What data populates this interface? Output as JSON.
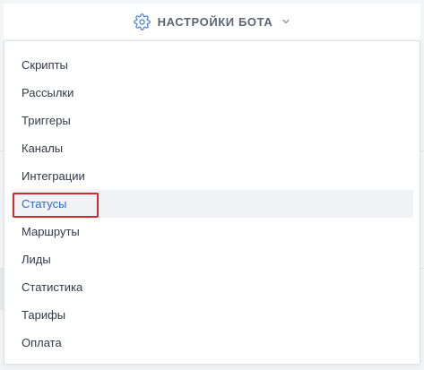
{
  "header": {
    "title": "НАСТРОЙКИ БОТА",
    "icon": "gear-icon",
    "dropdown_icon": "chevron-down-icon"
  },
  "menu": {
    "items": [
      {
        "label": "Скрипты"
      },
      {
        "label": "Рассылки"
      },
      {
        "label": "Триггеры"
      },
      {
        "label": "Каналы"
      },
      {
        "label": "Интеграции"
      },
      {
        "label": "Статусы",
        "selected": true
      },
      {
        "label": "Маршруты"
      },
      {
        "label": "Лиды"
      },
      {
        "label": "Статистика"
      },
      {
        "label": "Тарифы"
      },
      {
        "label": "Оплата"
      }
    ]
  },
  "colors": {
    "header_text": "#5a6677",
    "menu_text": "#2f3a4a",
    "selected_text": "#2e6ec4",
    "selected_background": "#f0f2f5",
    "highlight_border": "#d7262c"
  }
}
